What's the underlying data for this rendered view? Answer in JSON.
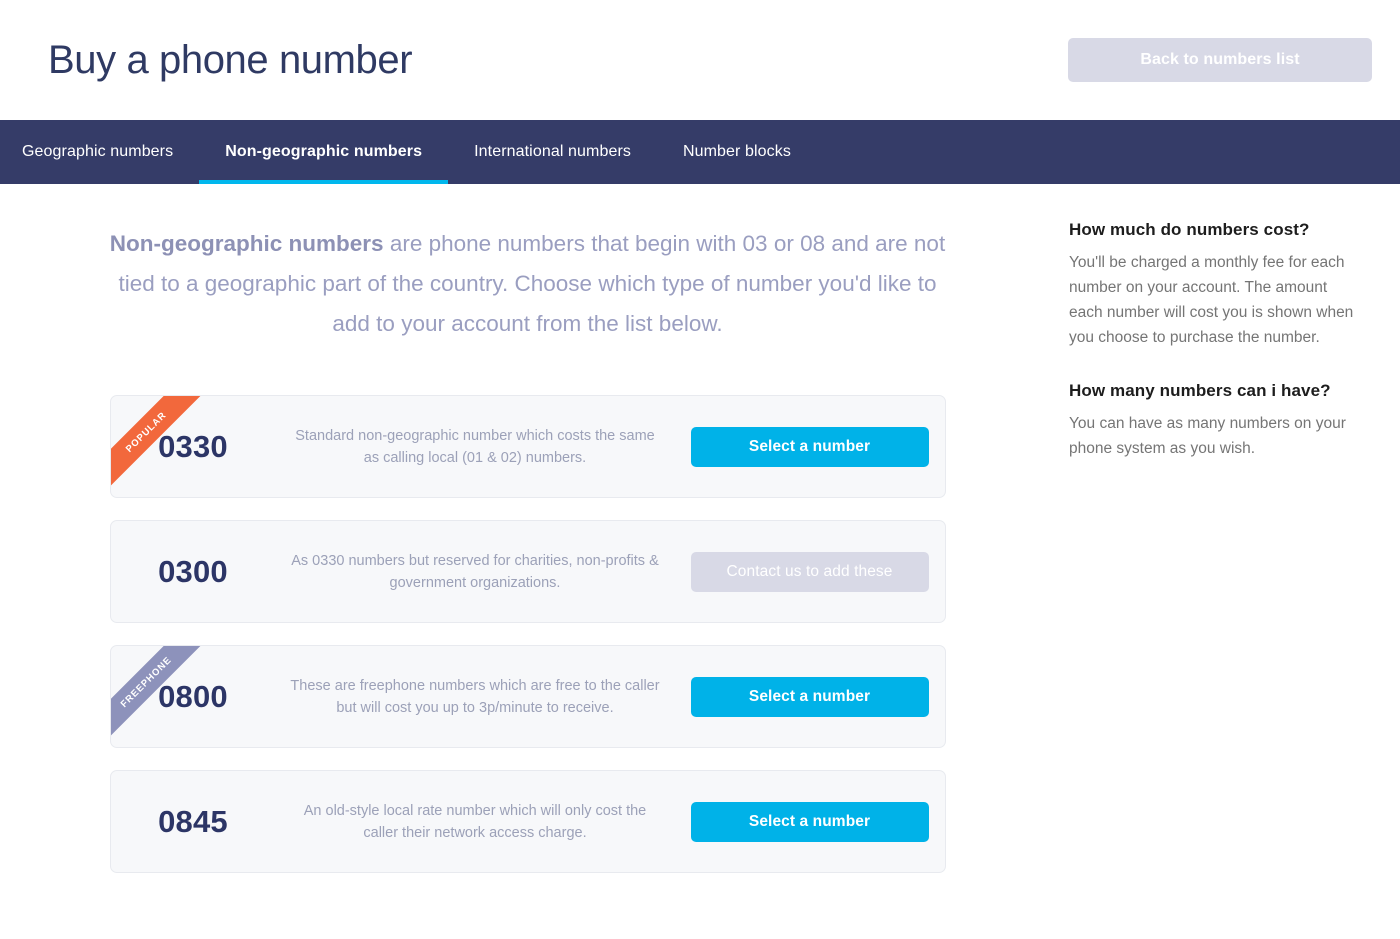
{
  "header": {
    "title": "Buy a phone number",
    "back_button_label": "Back to numbers list"
  },
  "tabs": [
    {
      "label": "Geographic numbers",
      "active": false
    },
    {
      "label": "Non-geographic numbers",
      "active": true
    },
    {
      "label": "International numbers",
      "active": false
    },
    {
      "label": "Number blocks",
      "active": false
    }
  ],
  "intro": {
    "lead": "Non-geographic numbers",
    "rest": " are phone numbers that begin with 03 or 08 and are not tied to a geographic part of the country. Choose which type of number you'd like to add to your account from the list below."
  },
  "cards": [
    {
      "number": "0330",
      "description": "Standard non-geographic number which costs the same as calling local (01 & 02) numbers.",
      "ribbon": "POPULAR",
      "ribbon_color": "#f2683c",
      "button_label": "Select a number",
      "button_enabled": true
    },
    {
      "number": "0300",
      "description": "As 0330 numbers but reserved for charities, non-profits & government organizations.",
      "ribbon": "",
      "ribbon_color": "",
      "button_label": "Contact us to add these",
      "button_enabled": false
    },
    {
      "number": "0800",
      "description": "These are freephone numbers which are free to the caller but will cost you up to 3p/minute to receive.",
      "ribbon": "FREEPHONE",
      "ribbon_color": "#8d92bb",
      "button_label": "Select a number",
      "button_enabled": true
    },
    {
      "number": "0845",
      "description": "An old-style local rate number which will only cost the caller their network access charge.",
      "ribbon": "",
      "ribbon_color": "",
      "button_label": "Select a number",
      "button_enabled": true
    }
  ],
  "sidebar": {
    "faqs": [
      {
        "question": "How much do numbers cost?",
        "answer": "You'll be charged a monthly fee for each number on your account. The amount each number will cost you is shown when you choose to purchase the number."
      },
      {
        "question": "How many numbers can i have?",
        "answer": "You can have as many numbers on your phone system as you wish."
      }
    ]
  },
  "colors": {
    "navy_bar": "#353c68",
    "accent_cyan": "#00b2e8",
    "tab_underline": "#00b7ed",
    "number_navy": "#2c3566",
    "disabled_gray": "#d8d9e6"
  }
}
